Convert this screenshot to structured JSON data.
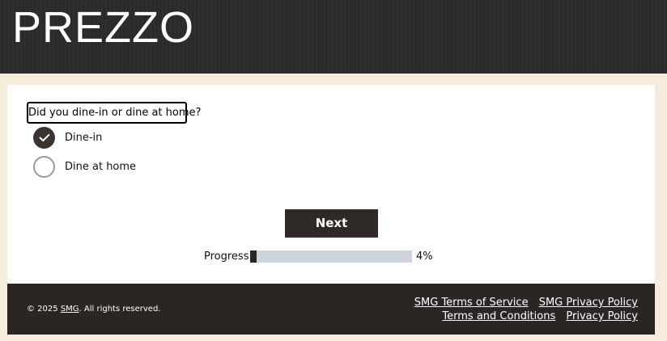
{
  "header": {
    "logo_text": "PREZZO"
  },
  "survey": {
    "question": "Did you dine-in or dine at home?",
    "options": [
      {
        "label": "Dine-in",
        "selected": true
      },
      {
        "label": "Dine at home",
        "selected": false
      }
    ],
    "next_label": "Next",
    "progress_label": "Progress",
    "progress_value": 4,
    "progress_text": "4%"
  },
  "footer": {
    "copyright_prefix": "© 2025 ",
    "copyright_brand": "SMG",
    "copyright_suffix": ". All rights reserved.",
    "links_row1": [
      "SMG Terms of Service",
      "SMG Privacy Policy"
    ],
    "links_row2": [
      "Terms and Conditions",
      "Privacy Policy"
    ]
  },
  "colors": {
    "header_bg": "#2b2b2b",
    "page_bg": "#f6ecdc",
    "button_bg": "#2f2a27",
    "progress_track": "#cfd4de",
    "footer_bg": "#2b2624"
  }
}
